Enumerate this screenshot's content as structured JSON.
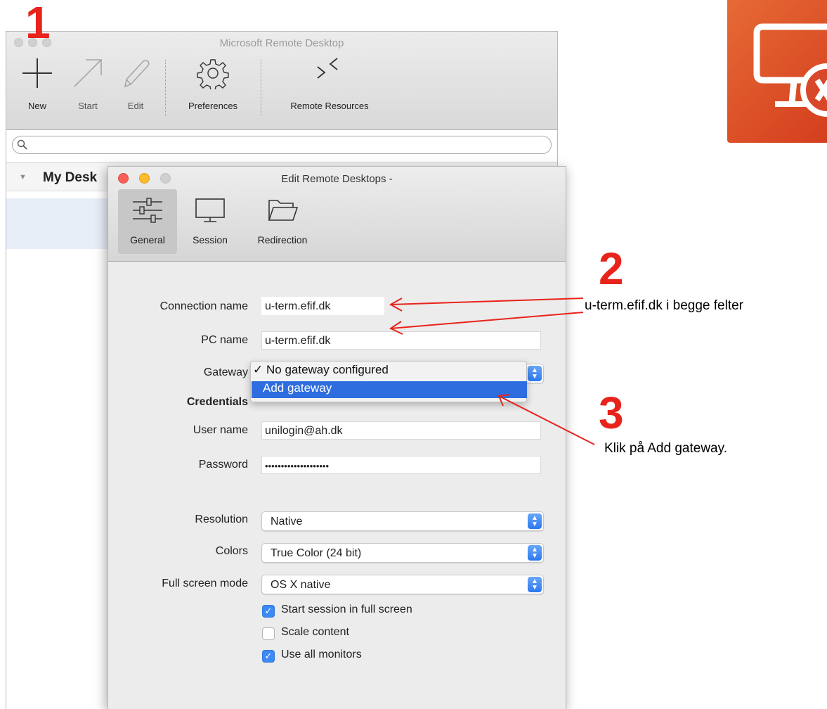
{
  "main_window": {
    "title": "Microsoft Remote Desktop",
    "toolbar": {
      "new_label": "New",
      "start_label": "Start",
      "edit_label": "Edit",
      "preferences_label": "Preferences",
      "remote_resources_label": "Remote Resources"
    },
    "search": {
      "placeholder": ""
    },
    "group_label": "My Desk"
  },
  "dialog": {
    "title": "Edit Remote Desktops -",
    "tabs": [
      {
        "label": "General",
        "icon": "sliders-icon",
        "active": true
      },
      {
        "label": "Session",
        "icon": "monitor-icon",
        "active": false
      },
      {
        "label": "Redirection",
        "icon": "folder-icon",
        "active": false
      }
    ],
    "form": {
      "connection_name_label": "Connection name",
      "connection_name_value": "u-term.efif.dk",
      "pc_name_label": "PC name",
      "pc_name_value": "u-term.efif.dk",
      "gateway_label": "Gateway",
      "gateway_options": [
        "No gateway configured",
        "Add gateway"
      ],
      "gateway_checked_mark": "✓",
      "credentials_label": "Credentials",
      "user_name_label": "User name",
      "user_name_value": "unilogin@ah.dk",
      "password_label": "Password",
      "password_value": "••••••••••••••••••••",
      "resolution_label": "Resolution",
      "resolution_value": "Native",
      "colors_label": "Colors",
      "colors_value": "True Color (24 bit)",
      "full_screen_mode_label": "Full screen mode",
      "full_screen_mode_value": "OS X native",
      "checkboxes": [
        {
          "label": "Start session in full screen",
          "checked": true
        },
        {
          "label": "Scale content",
          "checked": false
        },
        {
          "label": "Use all monitors",
          "checked": true
        }
      ]
    }
  },
  "annotations": {
    "step1": "1",
    "step2": "2",
    "step2_text": "u-term.efif.dk i begge felter",
    "step3": "3",
    "step3_text": "Klik på Add gateway.",
    "color": "#e8231b"
  },
  "colors": {
    "accent_blue": "#2e6de0",
    "logo_orange": "#d9472a"
  }
}
